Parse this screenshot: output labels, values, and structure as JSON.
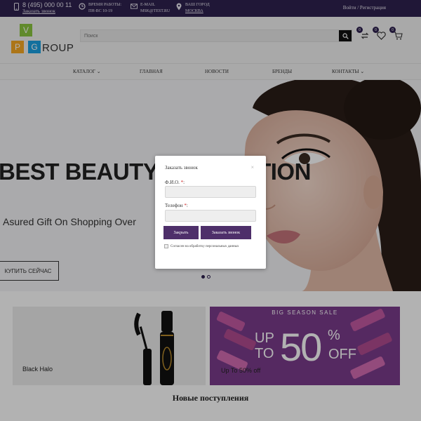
{
  "topbar": {
    "phone": "8 (495) 000 00 11",
    "callback_link": "Заказать звонок",
    "hours_label": "ВРЕМЯ РАБОТЫ:",
    "hours_value": "ПН-ВС 10-19",
    "email_label": "E-MAIL",
    "email_value": "MSK@TEST.RU",
    "city_label": "ВАШ ГОРОД",
    "city_value": "МОСКВА",
    "auth_link": "Войти / Регистрация",
    "bg_color": "#2f2250"
  },
  "logo": {
    "letter_v": "V",
    "letter_p": "P",
    "letter_g": "G",
    "text": "ROUP"
  },
  "search": {
    "placeholder": "Поиск"
  },
  "header_icons": {
    "compare": {
      "count": "0",
      "icon": "compare-icon"
    },
    "favorites": {
      "count": "0",
      "icon": "heart-icon"
    },
    "cart": {
      "count": "0",
      "icon": "cart-icon"
    }
  },
  "nav": {
    "items": [
      {
        "label": "КАТАЛОГ",
        "has_dropdown": true
      },
      {
        "label": "ГЛАВНАЯ",
        "has_dropdown": false
      },
      {
        "label": "НОВОСТИ",
        "has_dropdown": false
      },
      {
        "label": "БРЕНДЫ",
        "has_dropdown": false
      },
      {
        "label": "КОНТАКТЫ",
        "has_dropdown": true
      }
    ]
  },
  "hero": {
    "title": "BEST BEAUTY COLLECTION",
    "subtitle": "Asured Gift On Shopping Over",
    "button": "КУПИТЬ СЕЙЧАС",
    "slides": 2,
    "active_slide": 1
  },
  "banners": [
    {
      "label": "Black Halo"
    },
    {
      "label": "Up To 50% off",
      "top_text": "BIG SEASON SALE",
      "word_up": "UP",
      "word_to": "TO",
      "number": "50",
      "percent": "%",
      "word_off": "OFF"
    }
  ],
  "section": {
    "title": "Новые поступления"
  },
  "modal": {
    "title": "Заказать звонок",
    "close": "×",
    "name_label": "Ф.И.О.",
    "phone_label": "Телефон",
    "required_mark": "*",
    "name_value": "",
    "phone_value": "",
    "close_button": "Закрыть",
    "submit_button": "Заказать звонок",
    "consent": "Согласен на обработку персональных данных",
    "accent_color": "#4e2f6a"
  }
}
